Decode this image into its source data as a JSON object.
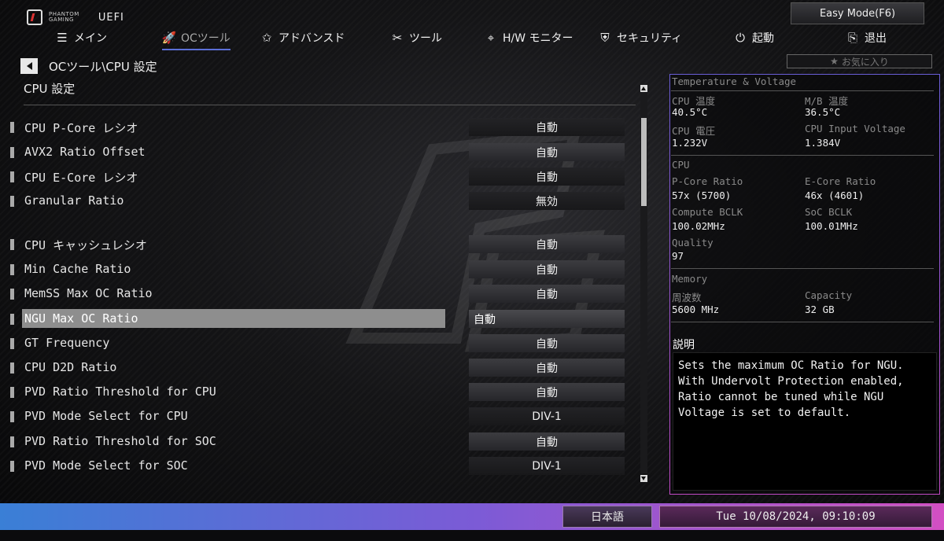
{
  "brand": {
    "line1": "PHANTOM",
    "line2": "GAMING",
    "uefi": "UEFI"
  },
  "easy_mode": "Easy Mode(F6)",
  "nav": [
    {
      "label": "メイン",
      "icon": "list-icon",
      "active": false
    },
    {
      "label": "OCツール",
      "icon": "rocket-icon",
      "active": true
    },
    {
      "label": "アドバンスド",
      "icon": "star-icon",
      "active": false
    },
    {
      "label": "ツール",
      "icon": "tools-icon",
      "active": false
    },
    {
      "label": "H/W モニター",
      "icon": "crosshair-icon",
      "active": false
    },
    {
      "label": "セキュリティ",
      "icon": "shield-icon",
      "active": false
    },
    {
      "label": "起動",
      "icon": "power-icon",
      "active": false
    },
    {
      "label": "退出",
      "icon": "exit-icon",
      "active": false
    }
  ],
  "breadcrumb": "OCツール\\CPU 設定",
  "section_title": "CPU 設定",
  "favorites": "お気に入り",
  "settings": [
    {
      "label": "CPU P-Core レシオ",
      "value": "自動"
    },
    {
      "label": "AVX2 Ratio Offset",
      "value": "自動"
    },
    {
      "label": "CPU E-Core レシオ",
      "value": "自動"
    },
    {
      "label": "Granular Ratio",
      "value": "無効"
    },
    {
      "label": "CPU  キャッシュレシオ",
      "value": "自動"
    },
    {
      "label": "Min Cache  Ratio",
      "value": "自動"
    },
    {
      "label": "MemSS Max OC Ratio",
      "value": "自動"
    },
    {
      "label": "NGU Max OC Ratio",
      "value": "自動"
    },
    {
      "label": "GT Frequency",
      "value": "自動"
    },
    {
      "label": "CPU D2D Ratio",
      "value": "自動"
    },
    {
      "label": "PVD Ratio Threshold for CPU",
      "value": "自動"
    },
    {
      "label": "PVD Mode Select for CPU",
      "value": "DIV-1"
    },
    {
      "label": "PVD Ratio Threshold for SOC",
      "value": "自動"
    },
    {
      "label": "PVD Mode Select for SOC",
      "value": "DIV-1"
    }
  ],
  "panel": {
    "tv_title": "Temperature & Voltage",
    "cpu_temp_k": "CPU 温度",
    "cpu_temp_v": "40.5°C",
    "mb_temp_k": "M/B 温度",
    "mb_temp_v": "36.5°C",
    "cpu_volt_k": "CPU 電圧",
    "cpu_volt_v": "1.232V",
    "cpu_in_k": "CPU Input Voltage",
    "cpu_in_v": "1.384V",
    "cpu_title": "CPU",
    "pcore_k": "P-Core Ratio",
    "pcore_v": "57x (5700)",
    "ecore_k": "E-Core Ratio",
    "ecore_v": "46x (4601)",
    "cbclk_k": "Compute BCLK",
    "cbclk_v": "100.02MHz",
    "sbclk_k": "SoC BCLK",
    "sbclk_v": "100.01MHz",
    "quality_k": "Quality",
    "quality_v": "97",
    "mem_title": "Memory",
    "freq_k": "周波数",
    "freq_v": "5600 MHz",
    "cap_k": "Capacity",
    "cap_v": "32 GB",
    "desc_title": "説明",
    "desc": "Sets the maximum OC Ratio for NGU.\nWith Undervolt Protection enabled,\nRatio cannot be tuned while NGU\nVoltage is set to default."
  },
  "footer": {
    "language": "日本語",
    "datetime": "Tue 10/08/2024, 09:10:09"
  }
}
